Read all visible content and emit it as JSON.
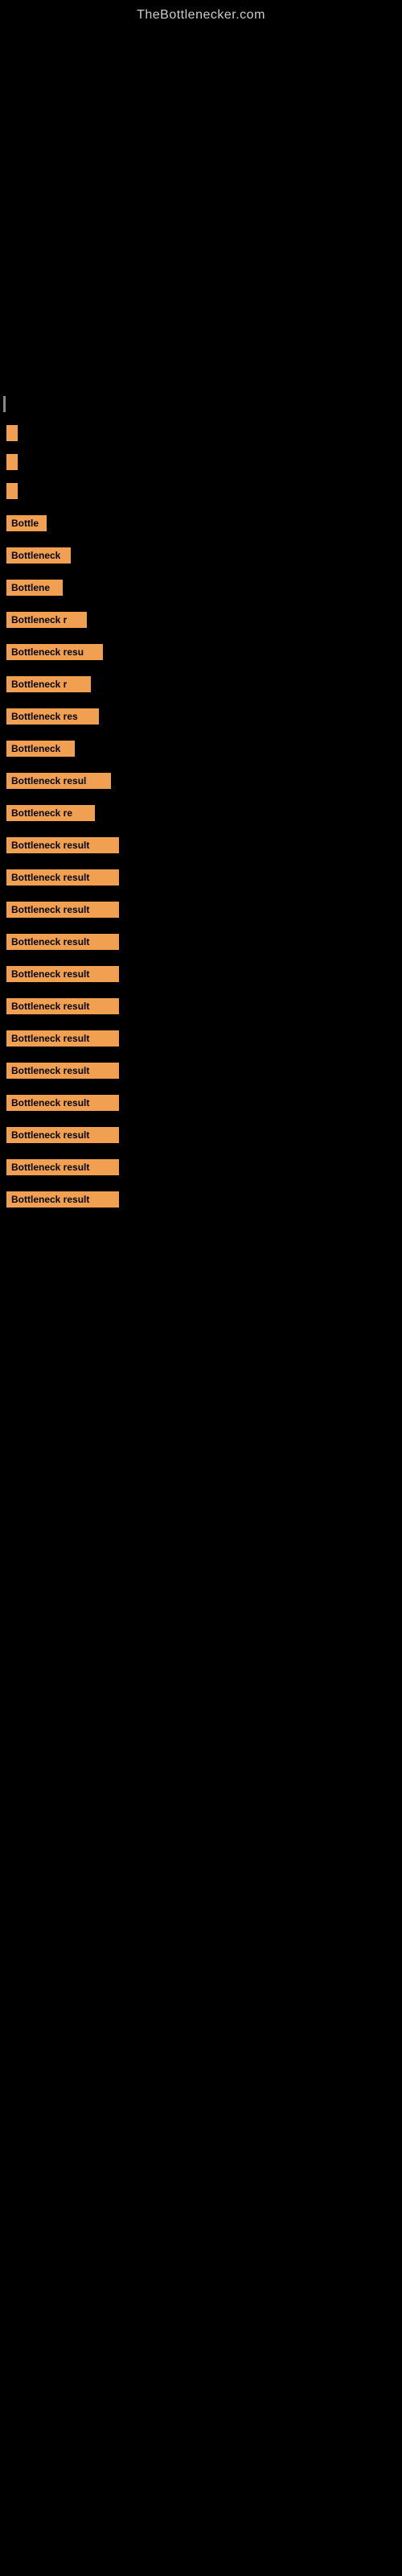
{
  "site": {
    "title": "TheBottlenecker.com"
  },
  "results": {
    "label": "Bottleneck result",
    "items": [
      {
        "id": 1,
        "label": "",
        "bar_class": "bar-1",
        "show_text": false
      },
      {
        "id": 2,
        "label": "",
        "bar_class": "bar-2",
        "show_text": false
      },
      {
        "id": 3,
        "label": "",
        "bar_class": "bar-3",
        "show_text": false
      },
      {
        "id": 4,
        "label": "Bottle",
        "bar_class": "bar-4",
        "show_text": true
      },
      {
        "id": 5,
        "label": "Bottleneck",
        "bar_class": "bar-5",
        "show_text": true
      },
      {
        "id": 6,
        "label": "Bottlene",
        "bar_class": "bar-6",
        "show_text": true
      },
      {
        "id": 7,
        "label": "Bottleneck r",
        "bar_class": "bar-7",
        "show_text": true
      },
      {
        "id": 8,
        "label": "Bottleneck resu",
        "bar_class": "bar-8",
        "show_text": true
      },
      {
        "id": 9,
        "label": "Bottleneck r",
        "bar_class": "bar-9",
        "show_text": true
      },
      {
        "id": 10,
        "label": "Bottleneck res",
        "bar_class": "bar-10",
        "show_text": true
      },
      {
        "id": 11,
        "label": "Bottleneck",
        "bar_class": "bar-11",
        "show_text": true
      },
      {
        "id": 12,
        "label": "Bottleneck resul",
        "bar_class": "bar-12",
        "show_text": true
      },
      {
        "id": 13,
        "label": "Bottleneck re",
        "bar_class": "bar-13",
        "show_text": true
      },
      {
        "id": 14,
        "label": "Bottleneck result",
        "bar_class": "bar-14",
        "show_text": true
      },
      {
        "id": 15,
        "label": "Bottleneck result",
        "bar_class": "bar-15",
        "show_text": true
      },
      {
        "id": 16,
        "label": "Bottleneck result",
        "bar_class": "bar-16",
        "show_text": true
      },
      {
        "id": 17,
        "label": "Bottleneck result",
        "bar_class": "bar-17",
        "show_text": true
      },
      {
        "id": 18,
        "label": "Bottleneck result",
        "bar_class": "bar-18",
        "show_text": true
      },
      {
        "id": 19,
        "label": "Bottleneck result",
        "bar_class": "bar-19",
        "show_text": true
      },
      {
        "id": 20,
        "label": "Bottleneck result",
        "bar_class": "bar-20",
        "show_text": true
      },
      {
        "id": 21,
        "label": "Bottleneck result",
        "bar_class": "bar-21",
        "show_text": true
      },
      {
        "id": 22,
        "label": "Bottleneck result",
        "bar_class": "bar-22",
        "show_text": true
      },
      {
        "id": 23,
        "label": "Bottleneck result",
        "bar_class": "bar-23",
        "show_text": true
      },
      {
        "id": 24,
        "label": "Bottleneck result",
        "bar_class": "bar-24",
        "show_text": true
      },
      {
        "id": 25,
        "label": "Bottleneck result",
        "bar_class": "bar-25",
        "show_text": true
      }
    ]
  }
}
